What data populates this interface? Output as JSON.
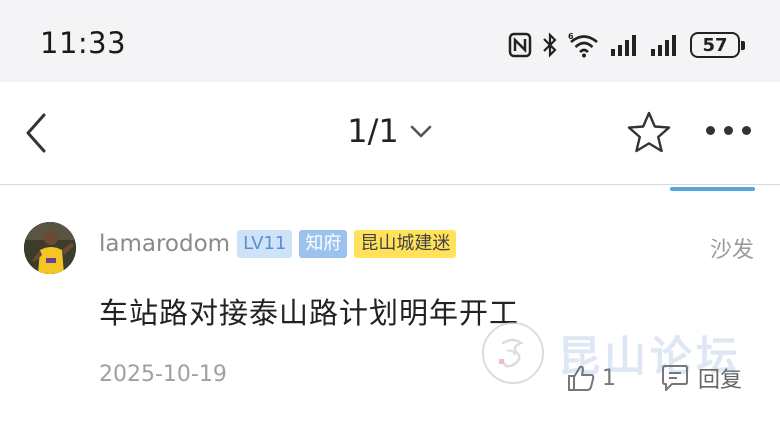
{
  "status_bar": {
    "time": "11:33",
    "battery": "57",
    "icons": [
      "nfc-icon",
      "bluetooth-icon",
      "wifi-6-icon",
      "signal-icon",
      "signal-icon",
      "battery-icon"
    ]
  },
  "nav": {
    "page_indicator": "1/1",
    "icons": [
      "back-arrow-icon",
      "chevron-down-icon",
      "star-icon",
      "more-icon"
    ]
  },
  "post": {
    "author": "lamarodom",
    "level_badge": "LV11",
    "title_badge": "知府",
    "group_badge": "昆山城建迷",
    "floor_label": "沙发",
    "content": "车站路对接泰山路计划明年开工",
    "date": "2025-10-19",
    "like_count": "1",
    "reply_label": "回复"
  },
  "watermark": {
    "text": "昆山论坛"
  },
  "colors": {
    "accent": "#5aa5dc",
    "level_badge_bg": "#cfe3f8",
    "title_badge_bg": "#9cc3ee",
    "group_badge_bg": "#ffe25a"
  }
}
